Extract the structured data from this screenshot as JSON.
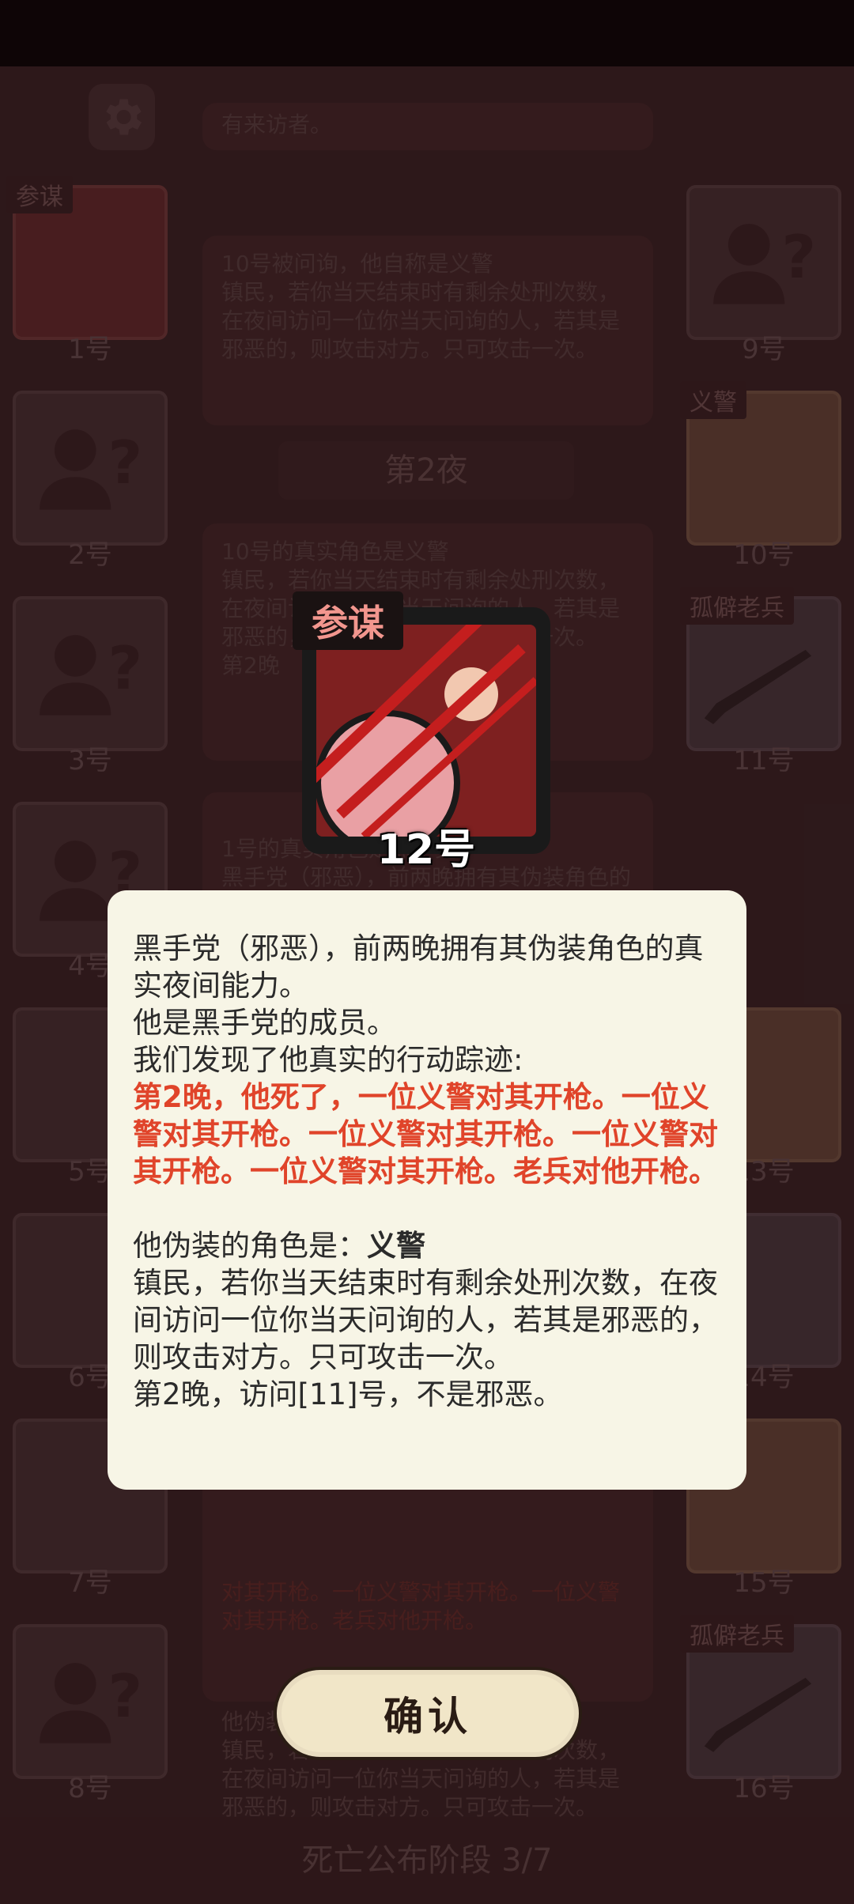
{
  "status_bar": {},
  "background": {
    "left_slots": [
      {
        "tag": "参谋",
        "number": "1号"
      },
      {
        "tag": "",
        "number": "2号"
      },
      {
        "tag": "",
        "number": "3号"
      },
      {
        "tag": "",
        "number": "4号"
      },
      {
        "tag": "",
        "number": "5号"
      },
      {
        "tag": "",
        "number": "6号"
      },
      {
        "tag": "",
        "number": "7号"
      },
      {
        "tag": "",
        "number": "8号"
      }
    ],
    "right_slots": [
      {
        "tag": "",
        "number": "9号"
      },
      {
        "tag": "义警",
        "number": "10号"
      },
      {
        "tag": "孤僻老兵",
        "number": "11号"
      },
      {
        "tag": "",
        "number": "13号"
      },
      {
        "tag": "老兵",
        "number": "14号"
      },
      {
        "tag": "",
        "number": "15号"
      },
      {
        "tag": "孤僻老兵",
        "number": "16号"
      }
    ],
    "log_top": "有来访者。",
    "log_1": "10号被问询，他自称是义警\n镇民，若你当天结束时有剩余处刑次数，在夜间访问一位你当天问询的人，若其是邪恶的，则攻击对方。只可攻击一次。",
    "night_label": "第2夜",
    "log_2": "10号的真实角色是义警\n镇民，若你当天结束时有剩余处刑次数，在夜间访问一位你当天问询的人，若其是邪恶的，则攻击对方。只可攻击一次。\n第2晚",
    "log_3": "1号的真实角色是黑手党\n黑手党（邪恶），前两晚拥有其伪装角色的真实夜间能力。",
    "log_4_red": "对其开枪。一位义警对其开枪。一位义警对其开枪。老兵对他开枪。",
    "log_4": "他伪装的角色是：义警\n镇民，若你当天结束时有剩余处刑次数，在夜间访问一位你当天问询的人，若其是邪恶的，则攻击对方。只可攻击一次。\n第2晚",
    "phase_label": "死亡公布阶段 3/7"
  },
  "popup": {
    "role": "参谋",
    "number": "12号",
    "line1": "黑手党（邪恶），前两晚拥有其伪装角色的真实夜间能力。",
    "line2": "他是黑手党的成员。",
    "line3": "我们发现了他真实的行动踪迹:",
    "red_text": "第2晚，他死了，一位义警对其开枪。一位义警对其开枪。一位义警对其开枪。一位义警对其开枪。一位义警对其开枪。老兵对他开枪。",
    "disguise_prefix": "他伪装的角色是：",
    "disguise_role": "义警",
    "disguise_desc": "镇民，若你当天结束时有剩余处刑次数，在夜间访问一位你当天问询的人，若其是邪恶的，则攻击对方。只可攻击一次。",
    "visit_line": "第2晚，访问[11]号，不是邪恶。",
    "confirm_label": "确认"
  },
  "colors": {
    "red_text": "#e0442a",
    "dialog_bg": "#f7f5e6",
    "button_bg": "#f1e6c8",
    "role_tag": "#f2968e"
  }
}
